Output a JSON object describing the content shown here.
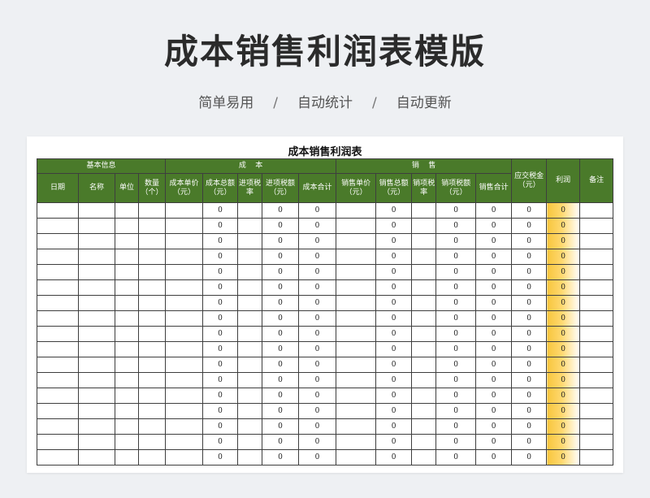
{
  "header": {
    "title": "成本销售利润表模版",
    "features": [
      "简单易用",
      "自动统计",
      "自动更新"
    ],
    "separator": "/"
  },
  "sheet": {
    "title": "成本销售利润表",
    "groups": {
      "basic": "基本信息",
      "cost": "成    本",
      "sales": "销    售",
      "tax": "应交税金（元）",
      "profit": "利润",
      "note": "备注"
    },
    "columns": [
      "日期",
      "名称",
      "单位",
      "数量（个）",
      "成本单价（元）",
      "成本总额（元）",
      "进项税率",
      "进项税额（元）",
      "成本合计",
      "销售单价（元）",
      "销售总额（元）",
      "销项税率",
      "销项税额（元）",
      "销售合计"
    ],
    "rows": [
      [
        "",
        "",
        "",
        "",
        "",
        "0",
        "",
        "0",
        "0",
        "",
        "0",
        "",
        "0",
        "0",
        "0",
        "0",
        ""
      ],
      [
        "",
        "",
        "",
        "",
        "",
        "0",
        "",
        "0",
        "0",
        "",
        "0",
        "",
        "0",
        "0",
        "0",
        "0",
        ""
      ],
      [
        "",
        "",
        "",
        "",
        "",
        "0",
        "",
        "0",
        "0",
        "",
        "0",
        "",
        "0",
        "0",
        "0",
        "0",
        ""
      ],
      [
        "",
        "",
        "",
        "",
        "",
        "0",
        "",
        "0",
        "0",
        "",
        "0",
        "",
        "0",
        "0",
        "0",
        "0",
        ""
      ],
      [
        "",
        "",
        "",
        "",
        "",
        "0",
        "",
        "0",
        "0",
        "",
        "0",
        "",
        "0",
        "0",
        "0",
        "0",
        ""
      ],
      [
        "",
        "",
        "",
        "",
        "",
        "0",
        "",
        "0",
        "0",
        "",
        "0",
        "",
        "0",
        "0",
        "0",
        "0",
        ""
      ],
      [
        "",
        "",
        "",
        "",
        "",
        "0",
        "",
        "0",
        "0",
        "",
        "0",
        "",
        "0",
        "0",
        "0",
        "0",
        ""
      ],
      [
        "",
        "",
        "",
        "",
        "",
        "0",
        "",
        "0",
        "0",
        "",
        "0",
        "",
        "0",
        "0",
        "0",
        "0",
        ""
      ],
      [
        "",
        "",
        "",
        "",
        "",
        "0",
        "",
        "0",
        "0",
        "",
        "0",
        "",
        "0",
        "0",
        "0",
        "0",
        ""
      ],
      [
        "",
        "",
        "",
        "",
        "",
        "0",
        "",
        "0",
        "0",
        "",
        "0",
        "",
        "0",
        "0",
        "0",
        "0",
        ""
      ],
      [
        "",
        "",
        "",
        "",
        "",
        "0",
        "",
        "0",
        "0",
        "",
        "0",
        "",
        "0",
        "0",
        "0",
        "0",
        ""
      ],
      [
        "",
        "",
        "",
        "",
        "",
        "0",
        "",
        "0",
        "0",
        "",
        "0",
        "",
        "0",
        "0",
        "0",
        "0",
        ""
      ],
      [
        "",
        "",
        "",
        "",
        "",
        "0",
        "",
        "0",
        "0",
        "",
        "0",
        "",
        "0",
        "0",
        "0",
        "0",
        ""
      ],
      [
        "",
        "",
        "",
        "",
        "",
        "0",
        "",
        "0",
        "0",
        "",
        "0",
        "",
        "0",
        "0",
        "0",
        "0",
        ""
      ],
      [
        "",
        "",
        "",
        "",
        "",
        "0",
        "",
        "0",
        "0",
        "",
        "0",
        "",
        "0",
        "0",
        "0",
        "0",
        ""
      ],
      [
        "",
        "",
        "",
        "",
        "",
        "0",
        "",
        "0",
        "0",
        "",
        "0",
        "",
        "0",
        "0",
        "0",
        "0",
        ""
      ],
      [
        "",
        "",
        "",
        "",
        "",
        "0",
        "",
        "0",
        "0",
        "",
        "0",
        "",
        "0",
        "0",
        "0",
        "0",
        ""
      ]
    ],
    "colors": {
      "header_green": "#4a7a2a",
      "profit_gold": "#f7c53d",
      "page_background": "#eef0f3"
    }
  }
}
